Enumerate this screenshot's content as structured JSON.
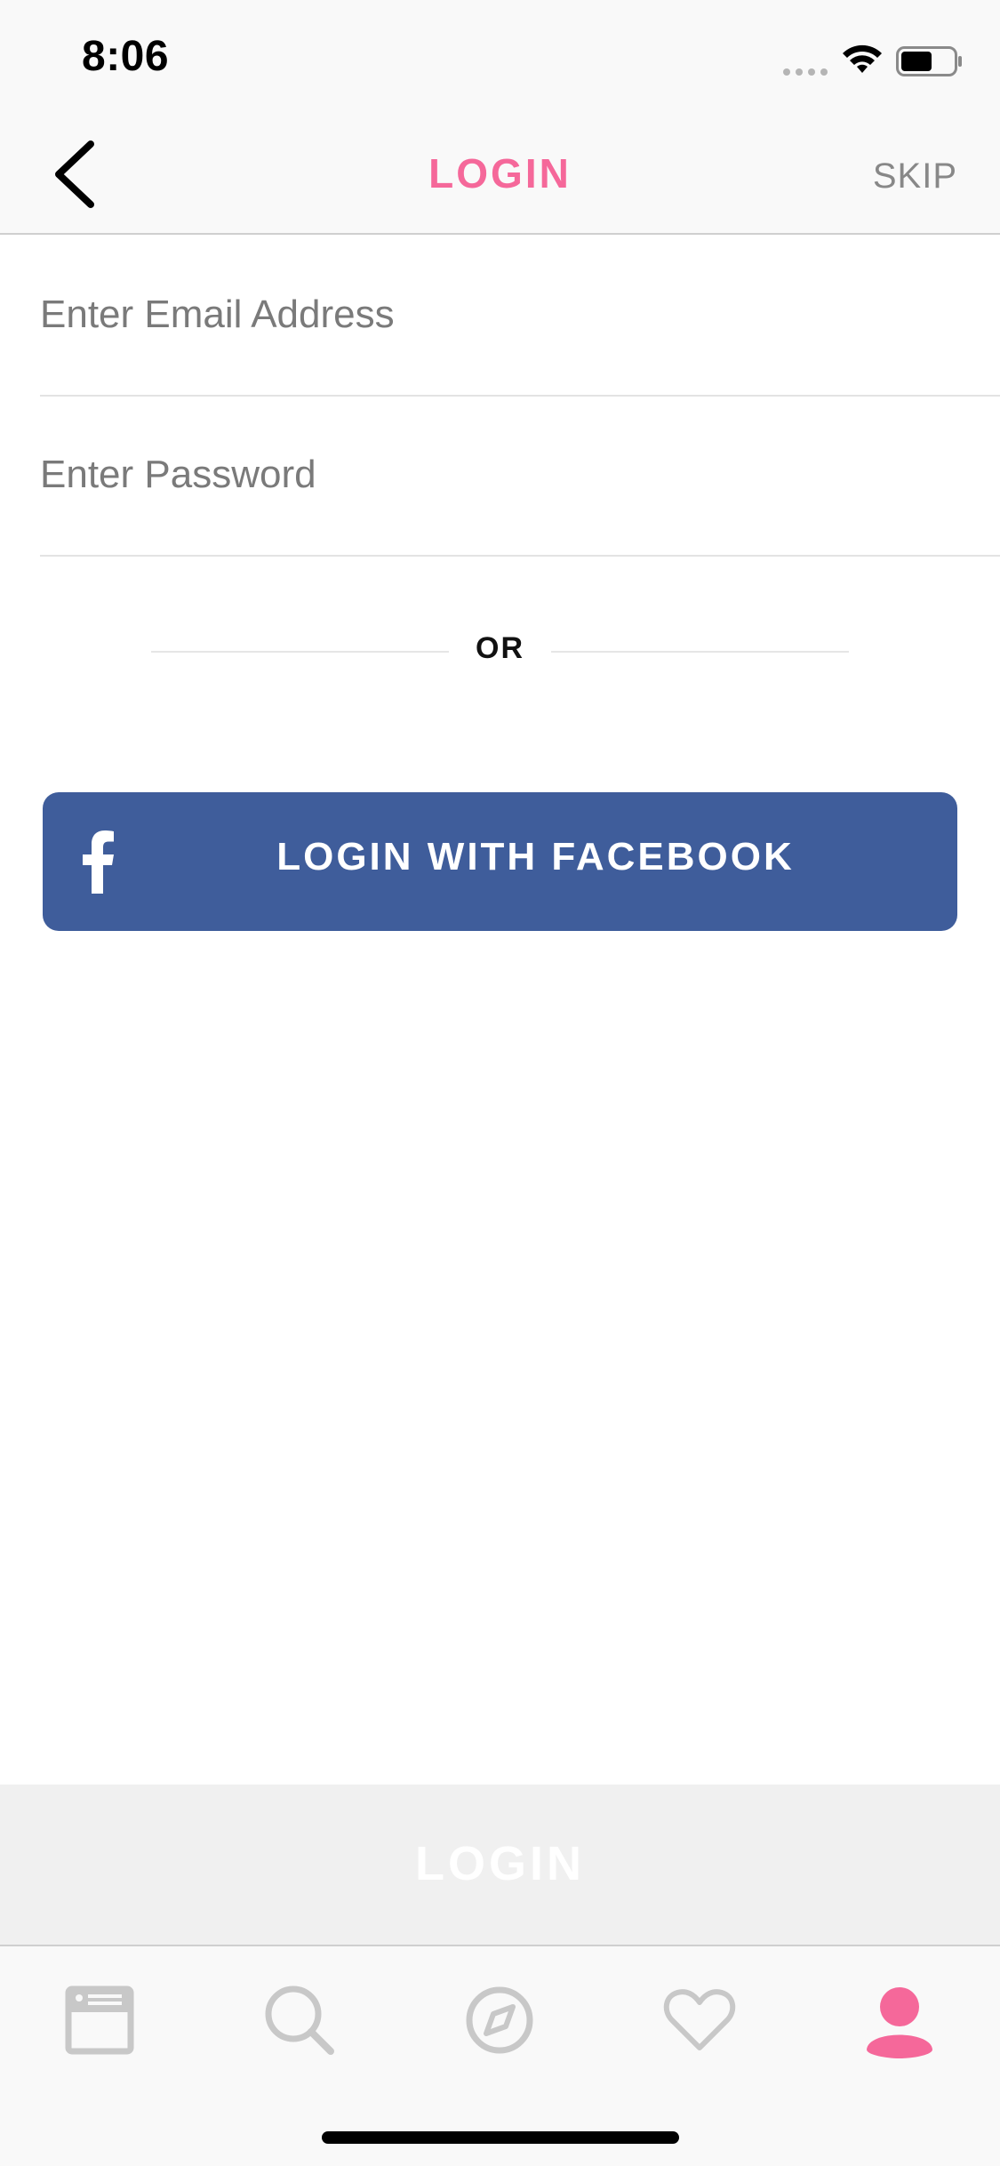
{
  "status_bar": {
    "time": "8:06"
  },
  "nav": {
    "title": "LOGIN",
    "skip_label": "SKIP"
  },
  "form": {
    "email_placeholder": "Enter Email Address",
    "password_placeholder": "Enter Password",
    "or_label": "OR",
    "facebook_label": "LOGIN WITH FACEBOOK",
    "submit_label": "LOGIN"
  },
  "tab_bar": {
    "items": [
      {
        "icon": "news-card-icon",
        "active": false
      },
      {
        "icon": "search-icon",
        "active": false
      },
      {
        "icon": "compass-icon",
        "active": false
      },
      {
        "icon": "heart-icon",
        "active": false
      },
      {
        "icon": "profile-icon",
        "active": true
      }
    ]
  },
  "colors": {
    "accent": "#f5689a",
    "facebook": "#3f5d9b",
    "inactive_icon": "#c8c8c8",
    "disabled_button": "#f0f0f0"
  }
}
